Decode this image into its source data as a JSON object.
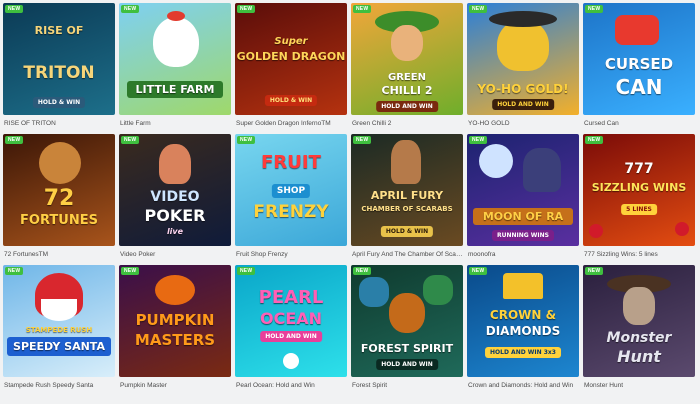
{
  "badge_label": "NEW",
  "games": [
    {
      "caption": "RISE OF TRITON",
      "art": {
        "line1": "RISE OF",
        "line2": "TRITON",
        "sub": "HOLD & WIN"
      },
      "colors": {
        "bg1": "#0b3a55",
        "bg2": "#1d6f8a",
        "text": "#f6d57a"
      }
    },
    {
      "caption": "Little Farm",
      "art": {
        "line1": "",
        "line2": "LITTLE FARM",
        "sub": ""
      },
      "colors": {
        "bg1": "#7ed0f2",
        "bg2": "#9fd86a",
        "text": "#ffffff"
      }
    },
    {
      "caption": "Super Golden Dragon InfernoTM",
      "art": {
        "line1": "Super",
        "line2": "GOLDEN DRAGON",
        "sub": "HOLD & WIN"
      },
      "colors": {
        "bg1": "#5a0d0a",
        "bg2": "#b5320f",
        "text": "#ffd65a"
      }
    },
    {
      "caption": "Green Chilli 2",
      "art": {
        "line1": "GREEN",
        "line2": "CHILLI 2",
        "sub": "HOLD AND WIN"
      },
      "colors": {
        "bg1": "#f2a63a",
        "bg2": "#6fae2b",
        "text": "#ffffff"
      }
    },
    {
      "caption": "YO-HO GOLD",
      "art": {
        "line1": "",
        "line2": "YO-HO GOLD!",
        "sub": "HOLD AND WIN"
      },
      "colors": {
        "bg1": "#2b7fd8",
        "bg2": "#f3b02a",
        "text": "#ffd23b"
      }
    },
    {
      "caption": "Cursed Can",
      "art": {
        "line1": "CURSED",
        "line2": "CAN",
        "sub": ""
      },
      "colors": {
        "bg1": "#1d74c8",
        "bg2": "#3ab0ff",
        "text": "#ffffff"
      }
    },
    {
      "caption": "72 FortunesTM",
      "art": {
        "line1": "72",
        "line2": "FORTUNES",
        "sub": ""
      },
      "colors": {
        "bg1": "#3b1607",
        "bg2": "#a8541b",
        "text": "#ffcf45"
      }
    },
    {
      "caption": "Video Poker",
      "art": {
        "line1": "VIDEO",
        "line2": "POKER",
        "sub": "live"
      },
      "colors": {
        "bg1": "#3a2a1e",
        "bg2": "#0f1b3a",
        "text": "#ffffff"
      }
    },
    {
      "caption": "Fruit Shop Frenzy",
      "art": {
        "line1": "FRUIT",
        "line2": "FRENZY",
        "sub": "SHOP"
      },
      "colors": {
        "bg1": "#78d6ef",
        "bg2": "#3ba7d8",
        "text": "#ff3b3b"
      }
    },
    {
      "caption": "April Fury And The Chamber Of ScarabsTM",
      "art": {
        "line1": "APRIL FURY",
        "line2": "CHAMBER OF SCARABS",
        "sub": "HOLD & WIN"
      },
      "colors": {
        "bg1": "#1b2a24",
        "bg2": "#6a4a22",
        "text": "#ffe08a"
      }
    },
    {
      "caption": "moonofra",
      "art": {
        "line1": "MOON OF RA",
        "line2": "",
        "sub": "RUNNING WINS"
      },
      "colors": {
        "bg1": "#1c2370",
        "bg2": "#5a2fa0",
        "text": "#ffcf45"
      }
    },
    {
      "caption": "777 Sizzling Wins: 5 lines",
      "art": {
        "line1": "777",
        "line2": "SIZZLING WINS",
        "sub": "5 LINES"
      },
      "colors": {
        "bg1": "#7a0b08",
        "bg2": "#e44d11",
        "text": "#ffe45a"
      }
    },
    {
      "caption": "Stampede Rush Speedy Santa",
      "art": {
        "line1": "STAMPEDE RUSH",
        "line2": "SPEEDY SANTA",
        "sub": ""
      },
      "colors": {
        "bg1": "#6fb6e8",
        "bg2": "#d8eefa",
        "text": "#ffffff"
      }
    },
    {
      "caption": "Pumpkin Master",
      "art": {
        "line1": "PUMPKIN",
        "line2": "MASTERS",
        "sub": ""
      },
      "colors": {
        "bg1": "#3a0f4a",
        "bg2": "#7a2a12",
        "text": "#ff9a1a"
      }
    },
    {
      "caption": "Pearl Ocean: Hold and Win",
      "art": {
        "line1": "PEARL",
        "line2": "OCEAN",
        "sub": "HOLD AND WIN"
      },
      "colors": {
        "bg1": "#0aa6c9",
        "bg2": "#2ee0ea",
        "text": "#ff5fb6"
      }
    },
    {
      "caption": "Forest Spirit",
      "art": {
        "line1": "FOREST SPIRIT",
        "line2": "",
        "sub": "HOLD AND WIN"
      },
      "colors": {
        "bg1": "#0f3a2e",
        "bg2": "#1f6a5a",
        "text": "#ffffff"
      }
    },
    {
      "caption": "Crown and Diamonds: Hold and Win",
      "art": {
        "line1": "CROWN &",
        "line2": "DIAMONDS",
        "sub": "HOLD AND WIN 3x3"
      },
      "colors": {
        "bg1": "#0a4a8a",
        "bg2": "#1d86d0",
        "text": "#ffd23b"
      }
    },
    {
      "caption": "Monster Hunt",
      "art": {
        "line1": "Monster",
        "line2": "Hunt",
        "sub": ""
      },
      "colors": {
        "bg1": "#2a1f3d",
        "bg2": "#5b4a6e",
        "text": "#e6e6ef"
      }
    }
  ]
}
